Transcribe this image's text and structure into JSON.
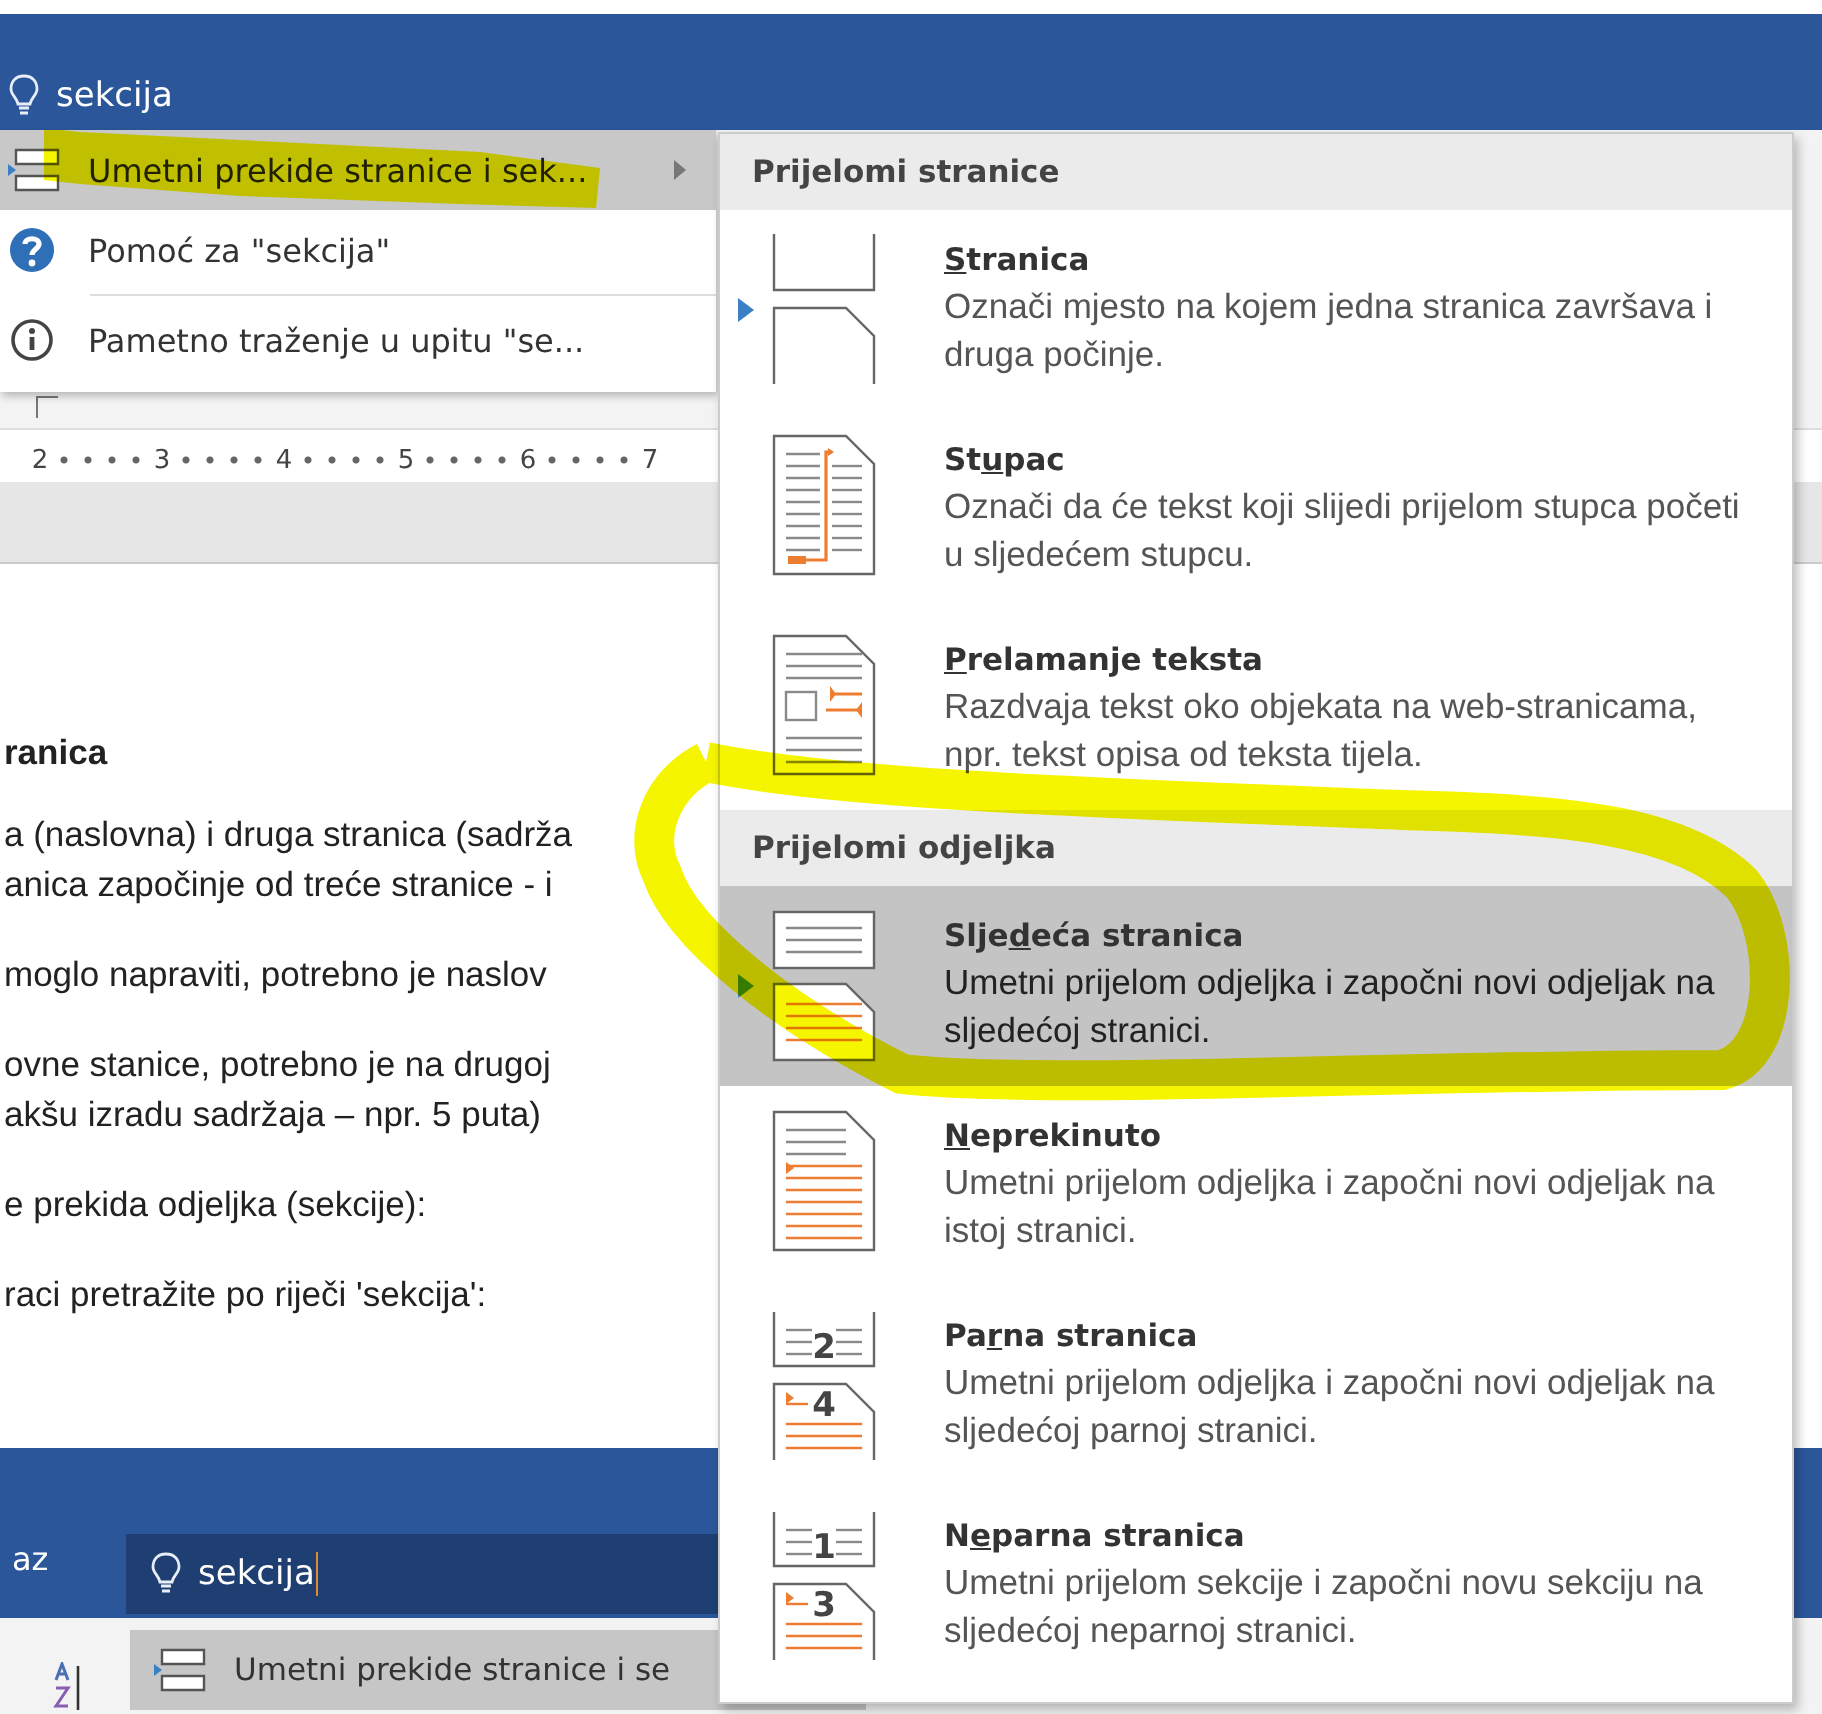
{
  "top_search": {
    "value": "sekcija"
  },
  "search_menu": [
    {
      "kind": "breaks",
      "label": "Umetni prekide stranice i sek...",
      "selected": true,
      "has_submenu": true,
      "highlighted": true
    },
    {
      "kind": "help",
      "label": "Pomoć za \"sekcija\"",
      "selected": false,
      "has_submenu": false,
      "highlighted": false
    },
    {
      "kind": "smart",
      "label": "Pametno traženje u upitu \"se...",
      "selected": false,
      "has_submenu": false,
      "highlighted": false
    }
  ],
  "ruler": [
    "2",
    "3",
    "4",
    "5",
    "6",
    "7"
  ],
  "document": {
    "heading": "ranica",
    "paragraphs": [
      [
        "a (naslovna) i druga stranica (sadrža",
        "anica započinje od treće stranice - i"
      ],
      [
        "moglo napraviti, potrebno je naslov"
      ],
      [
        "ovne stanice, potrebno je na drugoj",
        "akšu izradu sadržaja – npr. 5 puta)"
      ],
      [
        "e prekida odjeljka (sekcije):"
      ],
      [
        "raci pretražite po riječi 'sekcija':"
      ]
    ]
  },
  "bottom_bar": {
    "tab": "az",
    "search": {
      "value": "sekcija"
    },
    "result": {
      "label": "Umetni prekide stranice i se",
      "selected": true
    }
  },
  "submenu": {
    "sections": [
      {
        "header": "Prijelomi stranice",
        "items": [
          {
            "kind": "page",
            "title": [
              {
                "text": "S",
                "access_key": true
              },
              {
                "text": "tranica",
                "access_key": false
              }
            ],
            "description": "Označi mjesto na kojem jedna stranica završava i druga počinje.",
            "selected": false,
            "marked": true,
            "highlighted": false
          },
          {
            "kind": "column",
            "title": [
              {
                "text": "St",
                "access_key": false
              },
              {
                "text": "u",
                "access_key": true
              },
              {
                "text": "pac",
                "access_key": false
              }
            ],
            "description": "Označi da će tekst koji slijedi prijelom stupca početi u sljedećem stupcu.",
            "selected": false,
            "marked": false,
            "highlighted": false
          },
          {
            "kind": "wrap",
            "title": [
              {
                "text": "P",
                "access_key": true
              },
              {
                "text": "relamanje teksta",
                "access_key": false
              }
            ],
            "description": "Razdvaja tekst oko objekata na web-stranicama, npr. tekst opisa od teksta tijela.",
            "selected": false,
            "marked": false,
            "highlighted": false
          }
        ]
      },
      {
        "header": "Prijelomi odjeljka",
        "items": [
          {
            "kind": "next",
            "title": [
              {
                "text": "Slje",
                "access_key": false
              },
              {
                "text": "d",
                "access_key": true
              },
              {
                "text": "eća stranica",
                "access_key": false
              }
            ],
            "description": "Umetni prijelom odjeljka i započni novi odjeljak na sljedećoj stranici.",
            "selected": true,
            "marked": true,
            "highlighted": true
          },
          {
            "kind": "continuous",
            "title": [
              {
                "text": "N",
                "access_key": true
              },
              {
                "text": "eprekinuto",
                "access_key": false
              }
            ],
            "description": "Umetni prijelom odjeljka i započni novi odjeljak na istoj stranici.",
            "selected": false,
            "marked": false,
            "highlighted": false
          },
          {
            "kind": "numbered",
            "numbers": [
              "2",
              "4"
            ],
            "title": [
              {
                "text": "Pa",
                "access_key": false
              },
              {
                "text": "r",
                "access_key": true
              },
              {
                "text": "na stranica",
                "access_key": false
              }
            ],
            "description": "Umetni prijelom odjeljka i započni novi odjeljak na sljedećoj parnoj stranici.",
            "selected": false,
            "marked": false,
            "highlighted": false
          },
          {
            "kind": "numbered",
            "numbers": [
              "1",
              "3"
            ],
            "title": [
              {
                "text": "N",
                "access_key": false
              },
              {
                "text": "e",
                "access_key": true
              },
              {
                "text": "parna stranica",
                "access_key": false
              }
            ],
            "description": "Umetni prijelom sekcije i započni novu sekciju na sljedećoj neparnoj stranici.",
            "selected": false,
            "marked": false,
            "highlighted": false
          }
        ]
      }
    ]
  }
}
